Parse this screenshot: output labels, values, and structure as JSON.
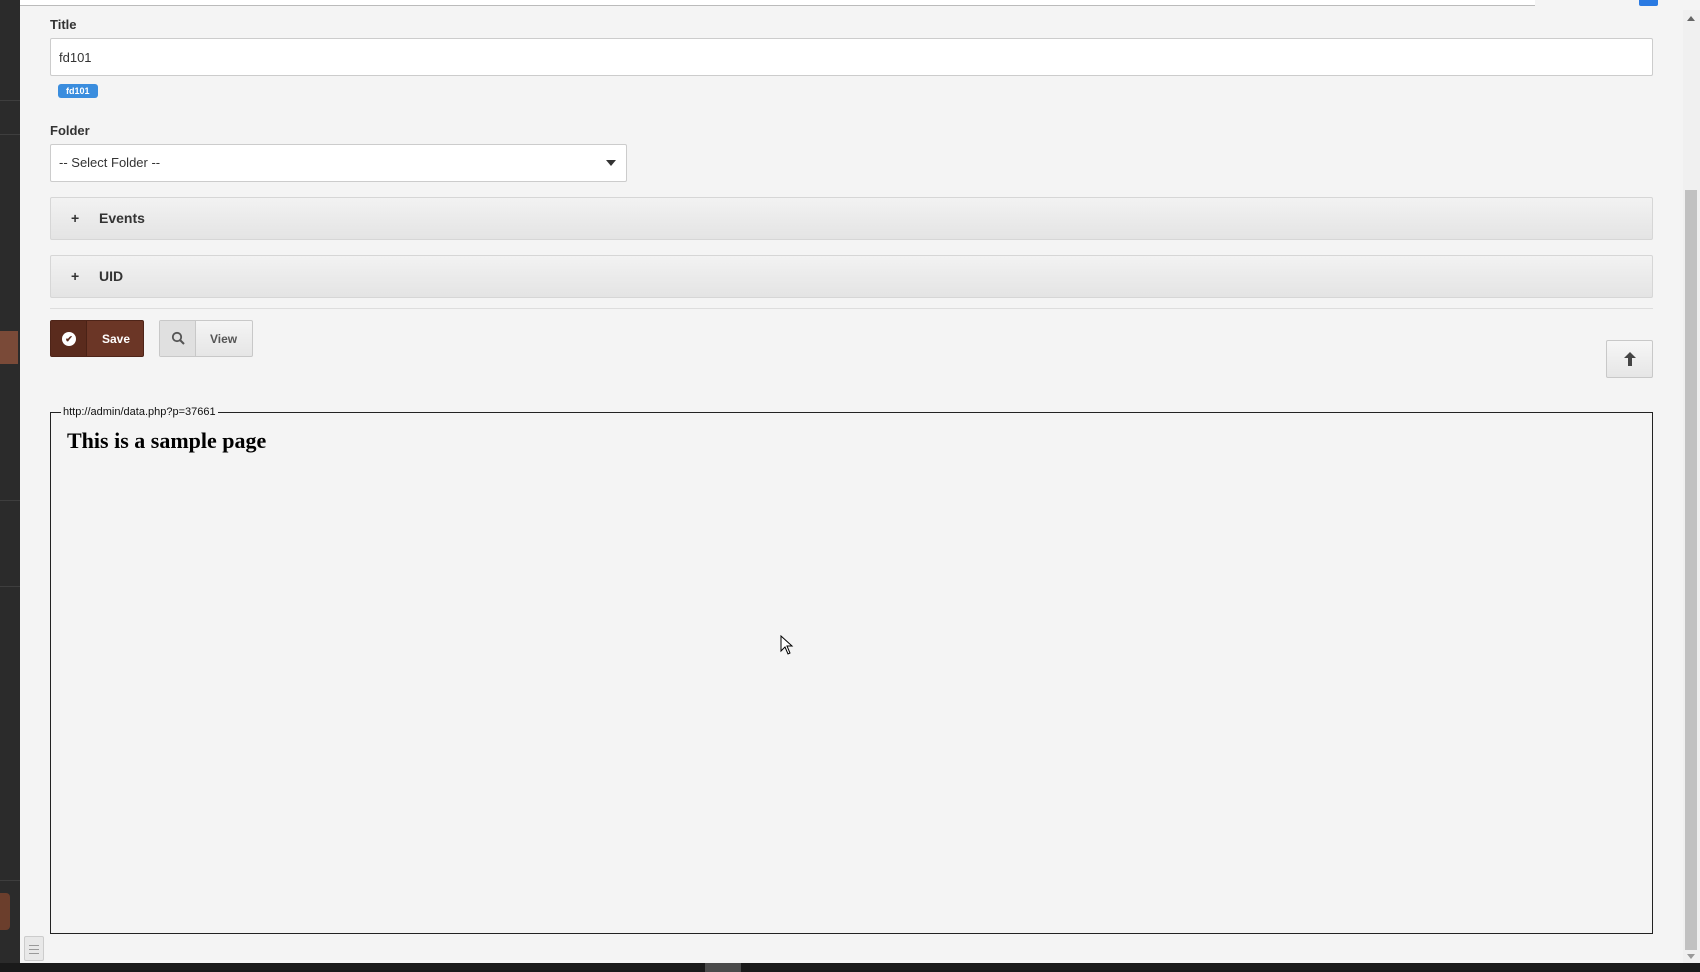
{
  "form": {
    "title_label": "Title",
    "title_value": "fd101",
    "title_tag": "fd101",
    "folder_label": "Folder",
    "folder_selected": "-- Select Folder --",
    "panels": [
      {
        "label": "Events",
        "expander": "+"
      },
      {
        "label": "UID",
        "expander": "+"
      }
    ]
  },
  "actions": {
    "save_label": "Save",
    "view_label": "View"
  },
  "preview": {
    "url": "http://admin/data.php?p=37661",
    "heading": "This is a sample page"
  },
  "icons": {
    "save": "check-circle-icon",
    "view": "search-icon",
    "scroll_top": "arrow-up-icon",
    "folder_caret": "caret-down-icon"
  },
  "colors": {
    "save_button": "#6b3626",
    "tag": "#3a8dde",
    "background": "#f4f4f4"
  }
}
